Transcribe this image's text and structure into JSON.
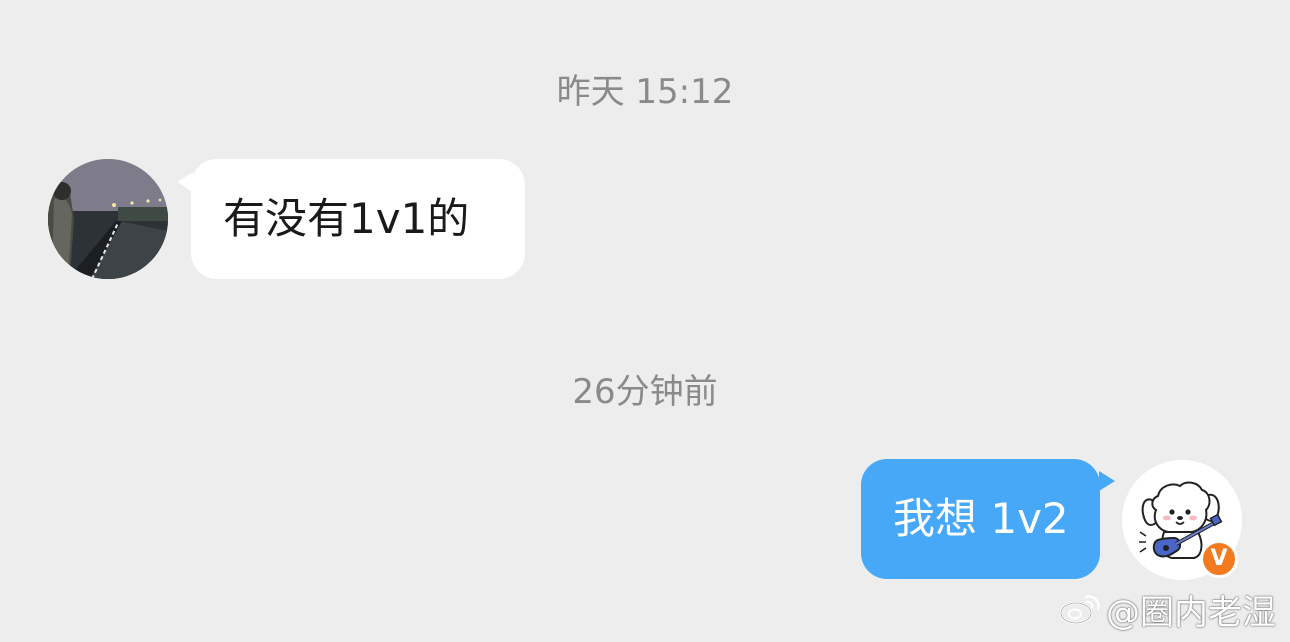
{
  "chat": {
    "timestamps": {
      "first": "昨天 15:12",
      "second": "26分钟前"
    },
    "messages": [
      {
        "side": "left",
        "text": "有没有1v1的"
      },
      {
        "side": "right",
        "text": "我想 1v2"
      }
    ],
    "badge_text": "V"
  },
  "colors": {
    "background": "#ededed",
    "incoming_bubble": "#ffffff",
    "outgoing_bubble": "#47a8f7",
    "timestamp_text": "#8a8a8a",
    "verified_badge": "#f47a1f"
  },
  "watermark": {
    "text": "@圈内老湿",
    "icon": "weibo-logo-icon"
  }
}
